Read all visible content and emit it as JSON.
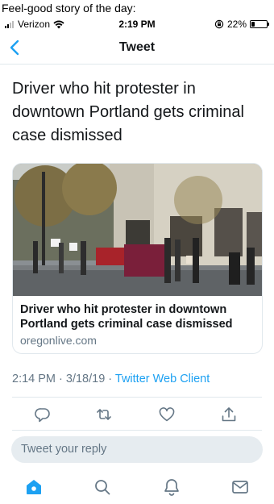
{
  "caption": "Feel-good story of the day:",
  "status_bar": {
    "carrier": "Verizon",
    "time": "2:19 PM",
    "battery": "22%",
    "battery_level": 0.22,
    "icons": [
      "signal-bars-icon",
      "wifi-icon",
      "rotation-lock-icon",
      "battery-icon"
    ]
  },
  "nav": {
    "title": "Tweet",
    "back_icon": "chevron-left-icon"
  },
  "tweet": {
    "text": "Driver who hit protester in downtown Portland gets criminal case dismissed",
    "timestamp": "2:14 PM · 3/18/19 · ",
    "client": "Twitter Web Client"
  },
  "card": {
    "title": "Driver who hit protester in downtown Portland gets criminal case dismissed",
    "domain": "oregonlive.com"
  },
  "actions": [
    "reply-icon",
    "retweet-icon",
    "like-icon",
    "share-icon"
  ],
  "reply": {
    "placeholder": "Tweet your reply"
  },
  "tabbar": [
    "home-icon",
    "search-icon",
    "notifications-icon",
    "messages-icon"
  ],
  "colors": {
    "accent": "#1da1f2",
    "secondary_text": "#657786",
    "divider": "#e1e8ed",
    "reply_bg": "#e6ecf0"
  }
}
